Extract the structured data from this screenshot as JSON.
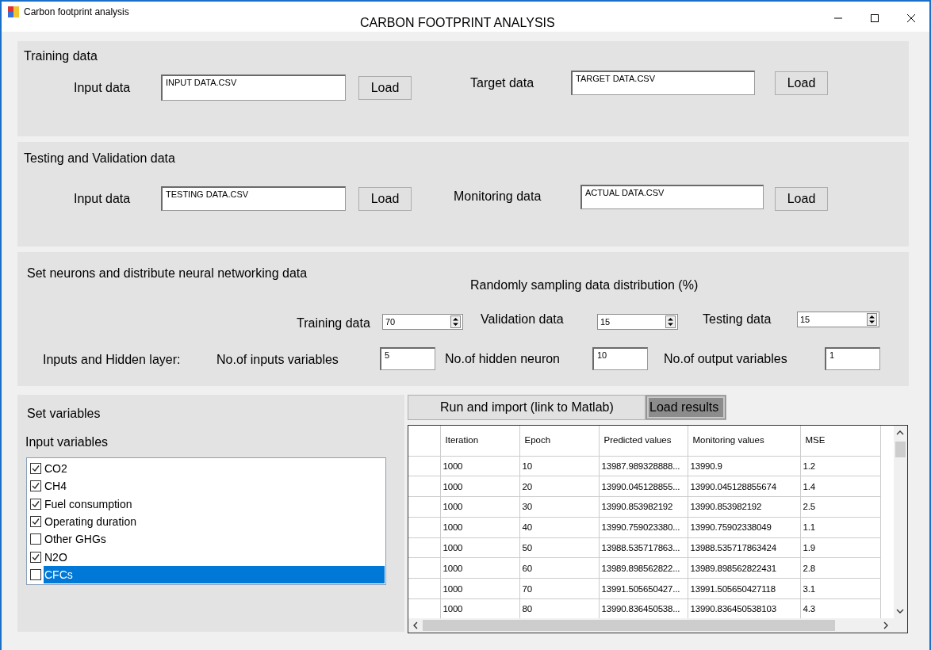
{
  "window": {
    "title": "Carbon footprint analysis",
    "heading": "CARBON FOOTPRINT ANALYSIS"
  },
  "training": {
    "title": "Training data",
    "fields": [
      {
        "label": "Input data",
        "value": "INPUT DATA.CSV",
        "button": "Load"
      },
      {
        "label": "Target data",
        "value": "TARGET DATA.CSV",
        "button": "Load"
      }
    ]
  },
  "testing": {
    "title": "Testing and Validation data",
    "fields": [
      {
        "label": "Input data",
        "value": "TESTING DATA.CSV",
        "button": "Load"
      },
      {
        "label": "Monitoring data",
        "value": "ACTUAL DATA.CSV",
        "button": "Load"
      }
    ]
  },
  "neurons": {
    "title": "Set neurons and distribute neural networking data",
    "subtitle": "Randomly sampling data distribution (%)",
    "spinners": [
      {
        "label": "Training data",
        "value": "70"
      },
      {
        "label": "Validation data",
        "value": "15"
      },
      {
        "label": "Testing data",
        "value": "15"
      }
    ],
    "layer_label": "Inputs and Hidden layer:",
    "counts": [
      {
        "label": "No.of inputs variables",
        "value": "5"
      },
      {
        "label": "No.of hidden neuron",
        "value": "10"
      },
      {
        "label": "No.of output variables",
        "value": "1"
      }
    ]
  },
  "variables": {
    "title": "Set variables",
    "list_title": "Input variables",
    "items": [
      {
        "label": "CO2",
        "checked": true,
        "selected": false
      },
      {
        "label": "CH4",
        "checked": true,
        "selected": false
      },
      {
        "label": "Fuel consumption",
        "checked": true,
        "selected": false
      },
      {
        "label": "Operating duration",
        "checked": true,
        "selected": false
      },
      {
        "label": "Other GHGs",
        "checked": false,
        "selected": false
      },
      {
        "label": "N2O",
        "checked": true,
        "selected": false
      },
      {
        "label": "CFCs",
        "checked": false,
        "selected": true
      }
    ]
  },
  "actions": [
    {
      "label": "Run and import (link to Matlab)",
      "pressed": false
    },
    {
      "label": "Load results",
      "pressed": true
    }
  ],
  "table": {
    "columns": [
      "Iteration",
      "Epoch",
      "Predicted values",
      "Monitoring values",
      "MSE"
    ],
    "rows": [
      [
        "1000",
        "10",
        "13987.989328888...",
        "13990.9",
        "1.2"
      ],
      [
        "1000",
        "20",
        "13990.045128855...",
        "13990.045128855674",
        "1.4"
      ],
      [
        "1000",
        "30",
        "13990.853982192",
        "13990.853982192",
        "2.5"
      ],
      [
        "1000",
        "40",
        "13990.759023380...",
        "13990.75902338049",
        "1.1"
      ],
      [
        "1000",
        "50",
        "13988.535717863...",
        "13988.535717863424",
        "1.9"
      ],
      [
        "1000",
        "60",
        "13989.898562822...",
        "13989.898562822431",
        "2.8"
      ],
      [
        "1000",
        "70",
        "13991.505650427...",
        "13991.505650427118",
        "3.1"
      ],
      [
        "1000",
        "80",
        "13990.836450538...",
        "13990.836450538103",
        "4.3"
      ]
    ]
  }
}
